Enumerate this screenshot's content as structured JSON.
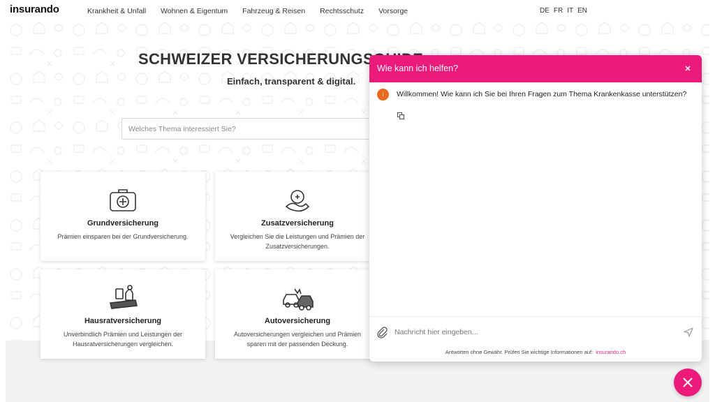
{
  "nav": {
    "logo": "insurando",
    "links": [
      "Krankheit & Unfall",
      "Wohnen & Eigentum",
      "Fahrzeug & Reisen",
      "Rechtsschutz",
      "Vorsorge"
    ],
    "languages": [
      "DE",
      "FR",
      "IT",
      "EN"
    ]
  },
  "hero": {
    "title": "SCHWEIZER VERSICHERUNGSGUIDE",
    "subtitle": "Einfach, transparent & digital."
  },
  "search": {
    "placeholder": "Welches Thema interessiert Sie?",
    "value": ""
  },
  "cards": [
    {
      "title": "Grundversicherung",
      "description": "Prämien einsparen bei der Grundversicherung.",
      "icon": "first-aid-kit-icon"
    },
    {
      "title": "Zusatzversicherung",
      "description": "Vergleichen Sie die Leistungen und Prämien der Zusatzversicherungen.",
      "icon": "helping-hand-icon"
    },
    {
      "title": "Hausratversicherung",
      "description": "Unverbindlich Prämien und Leistungen der Hausratversicherungen vergleichen.",
      "icon": "household-items-icon"
    },
    {
      "title": "Autoversicherung",
      "description": "Autoversicherungen vergleichen und Prämien sparen mit der passenden Deckung.",
      "icon": "car-crash-icon"
    }
  ],
  "chat": {
    "title": "Wie kann ich helfen?",
    "avatar_letter": "i",
    "welcome": "Willkommen! Wie kann ich Sie bei Ihren Fragen zum Thema Krankenkasse unterstützen?",
    "input_placeholder": "Nachricht hier eingeben...",
    "disclaimer": "Antworten ohne Gewähr. Prüfen Sie wichtige Informationen auf:",
    "disclaimer_link": "insurando.ch"
  },
  "colors": {
    "accent": "#ec1b7b",
    "avatar": "#e96a1e",
    "footer_bg": "#f2f2f2"
  }
}
